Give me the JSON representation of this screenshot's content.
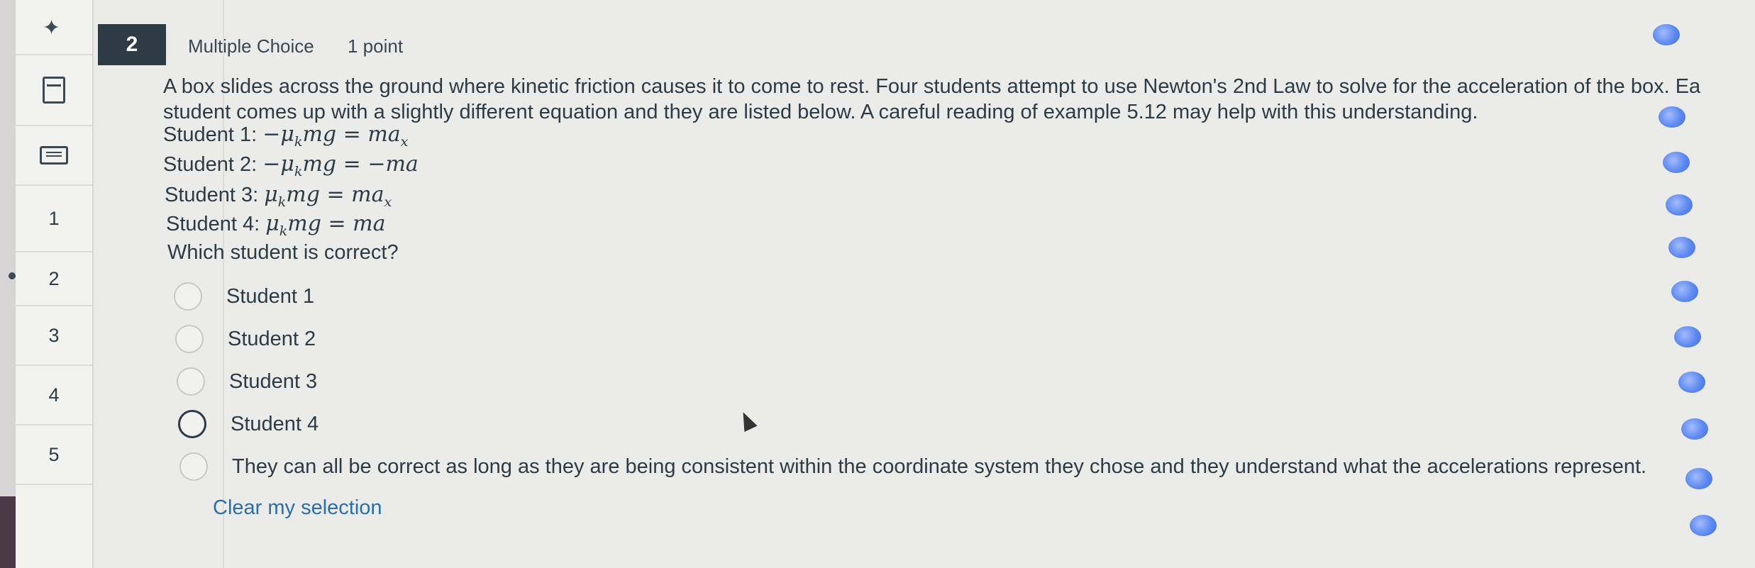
{
  "sidebar": {
    "items": [
      {
        "label": ""
      },
      {
        "label": ""
      },
      {
        "label": ""
      },
      {
        "label": "1"
      },
      {
        "label": "2"
      },
      {
        "label": "3"
      },
      {
        "label": "4"
      },
      {
        "label": "5"
      }
    ]
  },
  "question": {
    "number": "2",
    "type": "Multiple Choice",
    "points": "1 point",
    "prompt_line1": "A box slides across the ground where kinetic friction causes it to come to rest. Four students attempt to use Newton's 2nd Law to solve for the acceleration of the box. Ea",
    "prompt_line2": "student comes up with a slightly different equation and they are listed below. A careful reading of example 5.12 may help with this understanding.",
    "equations": [
      {
        "label": "Student 1: ",
        "lhs_sign": "−",
        "rhs_sign": "",
        "rhs_sub": "x"
      },
      {
        "label": "Student 2: ",
        "lhs_sign": "−",
        "rhs_sign": "−",
        "rhs_sub": ""
      },
      {
        "label": "Student 3: ",
        "lhs_sign": "",
        "rhs_sign": "",
        "rhs_sub": "x"
      },
      {
        "label": "Student 4: ",
        "lhs_sign": "",
        "rhs_sign": "",
        "rhs_sub": ""
      }
    ],
    "ask": "Which student is correct?",
    "choices": [
      {
        "label": "Student 1",
        "selected": false
      },
      {
        "label": "Student 2",
        "selected": false
      },
      {
        "label": "Student 3",
        "selected": false
      },
      {
        "label": "Student 4",
        "selected": false
      },
      {
        "label": "They can all be correct as long as they are being consistent within the coordinate system they chose and they understand what the accelerations represent.",
        "selected": false
      }
    ],
    "clear_label": "Clear my selection"
  },
  "colors": {
    "badge_bg": "#2d3b45",
    "link": "#2b6ea8",
    "text": "#2d3b45"
  }
}
